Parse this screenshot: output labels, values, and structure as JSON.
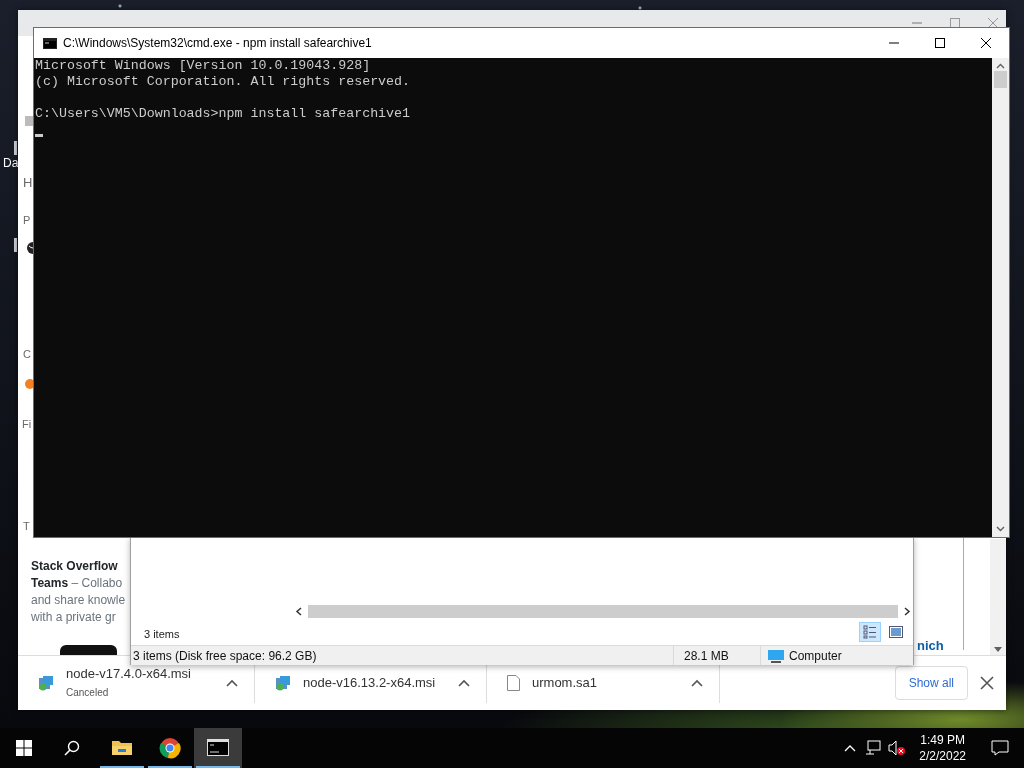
{
  "desktop": {
    "icon_label": "Da"
  },
  "browser": {
    "page_fragments": [
      {
        "kind": "heading",
        "text": "H"
      },
      {
        "kind": "label",
        "text": "P"
      },
      {
        "kind": "label",
        "text": "C"
      },
      {
        "kind": "label",
        "text": "Fi"
      },
      {
        "kind": "label",
        "text": "T"
      }
    ],
    "promo": {
      "title": "Stack Overflow",
      "lines": [
        "**Teams** – Collabo",
        "and share knowle",
        "with a private gr"
      ]
    },
    "link_fragment": "nich",
    "downloads": [
      {
        "kind": "installer",
        "name": "node-v17.4.0-x64.msi",
        "status": "Canceled"
      },
      {
        "kind": "installer",
        "name": "node-v16.13.2-x64.msi"
      },
      {
        "kind": "file",
        "name": "urmom.sa1"
      }
    ],
    "show_all": "Show all"
  },
  "explorer": {
    "item_count": "3 items",
    "views": [
      {
        "kind": "details",
        "selected": true
      },
      {
        "kind": "preview",
        "selected": false
      }
    ],
    "status_bar": {
      "summary": "3 items (Disk free space: 96.2 GB)",
      "size": "28.1 MB",
      "location": "Computer"
    }
  },
  "console": {
    "title": "C:\\Windows\\System32\\cmd.exe - npm  install safearchive1",
    "output": [
      "Microsoft Windows [Version 10.0.19043.928]",
      "(c) Microsoft Corporation. All rights reserved."
    ],
    "command": "C:\\Users\\VM5\\Downloads>npm install safearchive1",
    "cursor": true
  },
  "taskbar": {
    "apps": [
      {
        "kind": "folder",
        "running": true,
        "active": false
      },
      {
        "kind": "browser",
        "running": true,
        "active": false
      },
      {
        "kind": "console",
        "running": true,
        "active": true
      }
    ],
    "volume_muted": true,
    "clock": {
      "time": "1:49 PM",
      "date": "2/2/2022"
    }
  }
}
